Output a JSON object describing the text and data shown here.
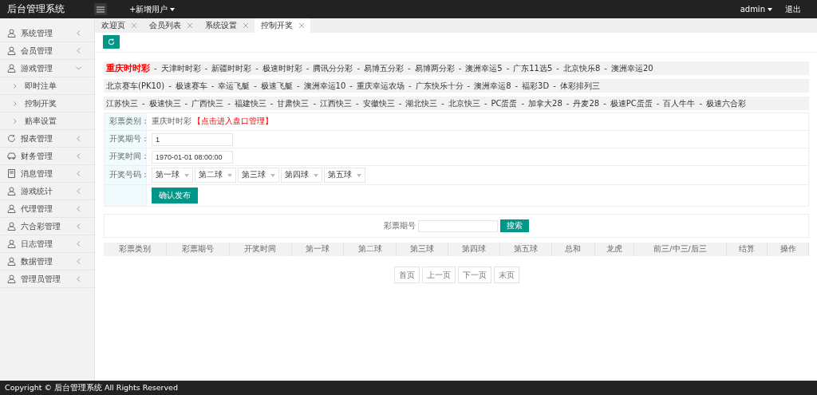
{
  "header": {
    "title": "后台管理系统",
    "add_user": "+新增用户",
    "user": "admin",
    "logout": "退出"
  },
  "sidebar": {
    "items": [
      {
        "label": "系统管理",
        "expanded": false
      },
      {
        "label": "会员管理",
        "expanded": false
      },
      {
        "label": "游戏管理",
        "expanded": true,
        "children": [
          {
            "label": "即时注单"
          },
          {
            "label": "控制开奖"
          },
          {
            "label": "赔率设置"
          }
        ]
      },
      {
        "label": "报表管理",
        "expanded": false
      },
      {
        "label": "财务管理",
        "expanded": false
      },
      {
        "label": "消息管理",
        "expanded": false
      },
      {
        "label": "游戏统计",
        "expanded": false
      },
      {
        "label": "代理管理",
        "expanded": false
      },
      {
        "label": "六合彩管理",
        "expanded": false
      },
      {
        "label": "日志管理",
        "expanded": false
      },
      {
        "label": "数据管理",
        "expanded": false
      },
      {
        "label": "管理员管理",
        "expanded": false
      }
    ]
  },
  "tabs": [
    {
      "label": "欢迎页",
      "selected": false
    },
    {
      "label": "会员列表",
      "selected": false
    },
    {
      "label": "系统设置",
      "selected": false
    },
    {
      "label": "控制开奖",
      "selected": true
    }
  ],
  "lottery_separator": "-",
  "lottery_rows": [
    [
      {
        "label": "重庆时时彩",
        "selected": true
      },
      {
        "label": "天津时时彩",
        "selected": false
      },
      {
        "label": "新疆时时彩",
        "selected": false
      },
      {
        "label": "极速时时彩",
        "selected": false
      },
      {
        "label": "腾讯分分彩",
        "selected": false
      },
      {
        "label": "易博五分彩",
        "selected": false
      },
      {
        "label": "易博两分彩",
        "selected": false
      },
      {
        "label": "澳洲幸运5",
        "selected": false
      },
      {
        "label": "广东11选5",
        "selected": false
      },
      {
        "label": "北京快乐8",
        "selected": false
      },
      {
        "label": "澳洲幸运20",
        "selected": false
      }
    ],
    [
      {
        "label": "北京赛车(PK10)",
        "selected": false
      },
      {
        "label": "极速赛车",
        "selected": false
      },
      {
        "label": "幸运飞艇",
        "selected": false
      },
      {
        "label": "极速飞艇",
        "selected": false
      },
      {
        "label": "澳洲幸运10",
        "selected": false
      },
      {
        "label": "重庆幸运农场",
        "selected": false
      },
      {
        "label": "广东快乐十分",
        "selected": false
      },
      {
        "label": "澳洲幸运8",
        "selected": false
      },
      {
        "label": "福彩3D",
        "selected": false
      },
      {
        "label": "体彩排列三",
        "selected": false
      }
    ],
    [
      {
        "label": "江苏快三",
        "selected": false
      },
      {
        "label": "极速快三",
        "selected": false
      },
      {
        "label": "广西快三",
        "selected": false
      },
      {
        "label": "福建快三",
        "selected": false
      },
      {
        "label": "甘肃快三",
        "selected": false
      },
      {
        "label": "江西快三",
        "selected": false
      },
      {
        "label": "安徽快三",
        "selected": false
      },
      {
        "label": "湖北快三",
        "selected": false
      },
      {
        "label": "北京快三",
        "selected": false
      },
      {
        "label": "PC蛋蛋",
        "selected": false
      },
      {
        "label": "加拿大28",
        "selected": false
      },
      {
        "label": "丹麦28",
        "selected": false
      },
      {
        "label": "极速PC蛋蛋",
        "selected": false
      },
      {
        "label": "百人牛牛",
        "selected": false
      },
      {
        "label": "极速六合彩",
        "selected": false
      }
    ]
  ],
  "form": {
    "type_label": "彩票类别：",
    "type_value": "重庆时时彩",
    "type_link": "【点击进入盘口管理】",
    "issue_label": "开奖期号：",
    "issue_value": "1",
    "time_label": "开奖时间：",
    "time_value": "1970-01-01 08:00:00",
    "numbers_label": "开奖号码：",
    "balls": [
      "第一球",
      "第二球",
      "第三球",
      "第四球",
      "第五球"
    ],
    "submit": "确认发布"
  },
  "search": {
    "label": "彩票期号",
    "button": "搜索"
  },
  "table": {
    "columns": [
      "彩票类别",
      "彩票期号",
      "开奖时间",
      "第一球",
      "第二球",
      "第三球",
      "第四球",
      "第五球",
      "总和",
      "龙虎",
      "前三/中三/后三",
      "结算",
      "操作"
    ]
  },
  "pagination": [
    "首页",
    "上一页",
    "下一页",
    "末页"
  ],
  "footer": "Copyright © 后台管理系统 All Rights Reserved"
}
